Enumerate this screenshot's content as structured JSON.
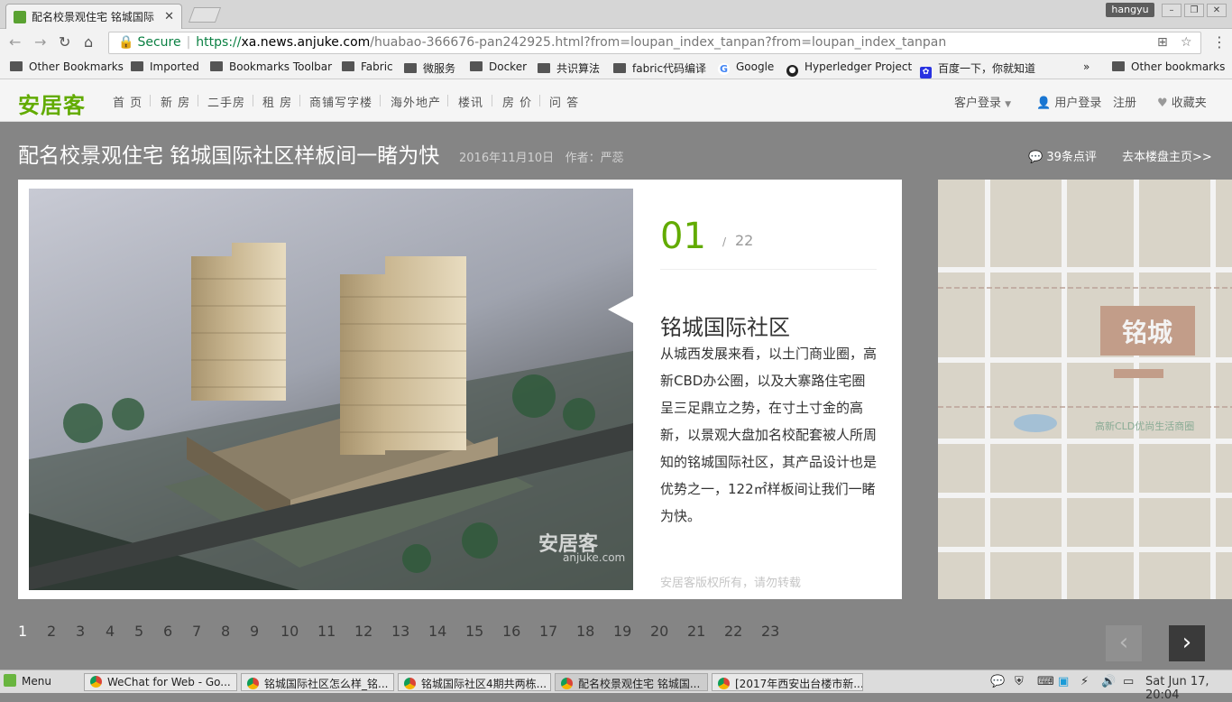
{
  "browser": {
    "active_tab_title": "配名校景观住宅 铭城国际",
    "user_name": "hangyu",
    "url": {
      "secure_label": "Secure",
      "scheme": "https://",
      "domain": "xa.news.anjuke.com",
      "path": "/huabao-366676-pan242925.html?from=loupan_index_tanpan?from=loupan_index_tanpan"
    },
    "bookmarks": [
      {
        "label": "Other Bookmarks",
        "icon": "folder-icon"
      },
      {
        "label": "Imported",
        "icon": "folder-icon"
      },
      {
        "label": "Bookmarks Toolbar",
        "icon": "folder-icon"
      },
      {
        "label": "Fabric",
        "icon": "folder-icon"
      },
      {
        "label": "微服务",
        "icon": "folder-icon"
      },
      {
        "label": "Docker",
        "icon": "folder-icon"
      },
      {
        "label": "共识算法",
        "icon": "folder-icon"
      },
      {
        "label": "fabric代码编译",
        "icon": "folder-icon"
      },
      {
        "label": "Google",
        "icon": "google-icon"
      },
      {
        "label": "Hyperledger Project",
        "icon": "github-icon"
      },
      {
        "label": "百度一下，你就知道",
        "icon": "baidu-icon"
      }
    ],
    "bookmarks_overflow": "»",
    "other_bookmarks": "Other bookmarks"
  },
  "site": {
    "logo": "安居客",
    "nav": [
      "首 页",
      "新 房",
      "二手房",
      "租 房",
      "商铺写字楼",
      "海外地产",
      "楼讯",
      "房 价",
      "问 答"
    ],
    "customer_login": "客户登录",
    "user_login": "用户登录",
    "register": "注册",
    "favorites": "收藏夹"
  },
  "article": {
    "title": "配名校景观住宅 铭城国际社区样板间一睹为快",
    "date": "2016年11月10日",
    "author": "作者：严蕊",
    "comments": "39条点评",
    "go_home": "去本楼盘主页>>"
  },
  "slide": {
    "current": "01",
    "separator": "/",
    "total": "22",
    "heading": "铭城国际社区",
    "description": "从城西发展来看，以土门商业圈，高新CBD办公圈，以及大寨路住宅圈呈三足鼎立之势，在寸土寸金的高新，以景观大盘加名校配套被人所周知的铭城国际社区，其产品设计也是优势之一，122㎡样板间让我们一睹为快。",
    "copyright": "安居客版权所有，请勿转载",
    "watermark": "安居客",
    "watermark_sub": "anjuke.com"
  },
  "map_labels": {
    "brand": "铭城",
    "area": "高新CLD优尚生活商圈"
  },
  "pager": {
    "pages": [
      "1",
      "2",
      "3",
      "4",
      "5",
      "6",
      "7",
      "8",
      "9",
      "10",
      "11",
      "12",
      "13",
      "14",
      "15",
      "16",
      "17",
      "18",
      "19",
      "20",
      "21",
      "22",
      "23"
    ],
    "current": "1",
    "prev": "‹",
    "next": "›"
  },
  "taskbar": {
    "menu": "Menu",
    "windows": [
      "WeChat for Web - Go...",
      "铭城国际社区怎么样_铭...",
      "铭城国际社区4期共两栋...",
      "配名校景观住宅 铭城国...",
      "[2017年西安出台楼市新..."
    ],
    "clock": "Sat Jun 17, 20:04"
  },
  "colors": {
    "brand_green": "#62ab00",
    "page_gray": "#858585"
  }
}
